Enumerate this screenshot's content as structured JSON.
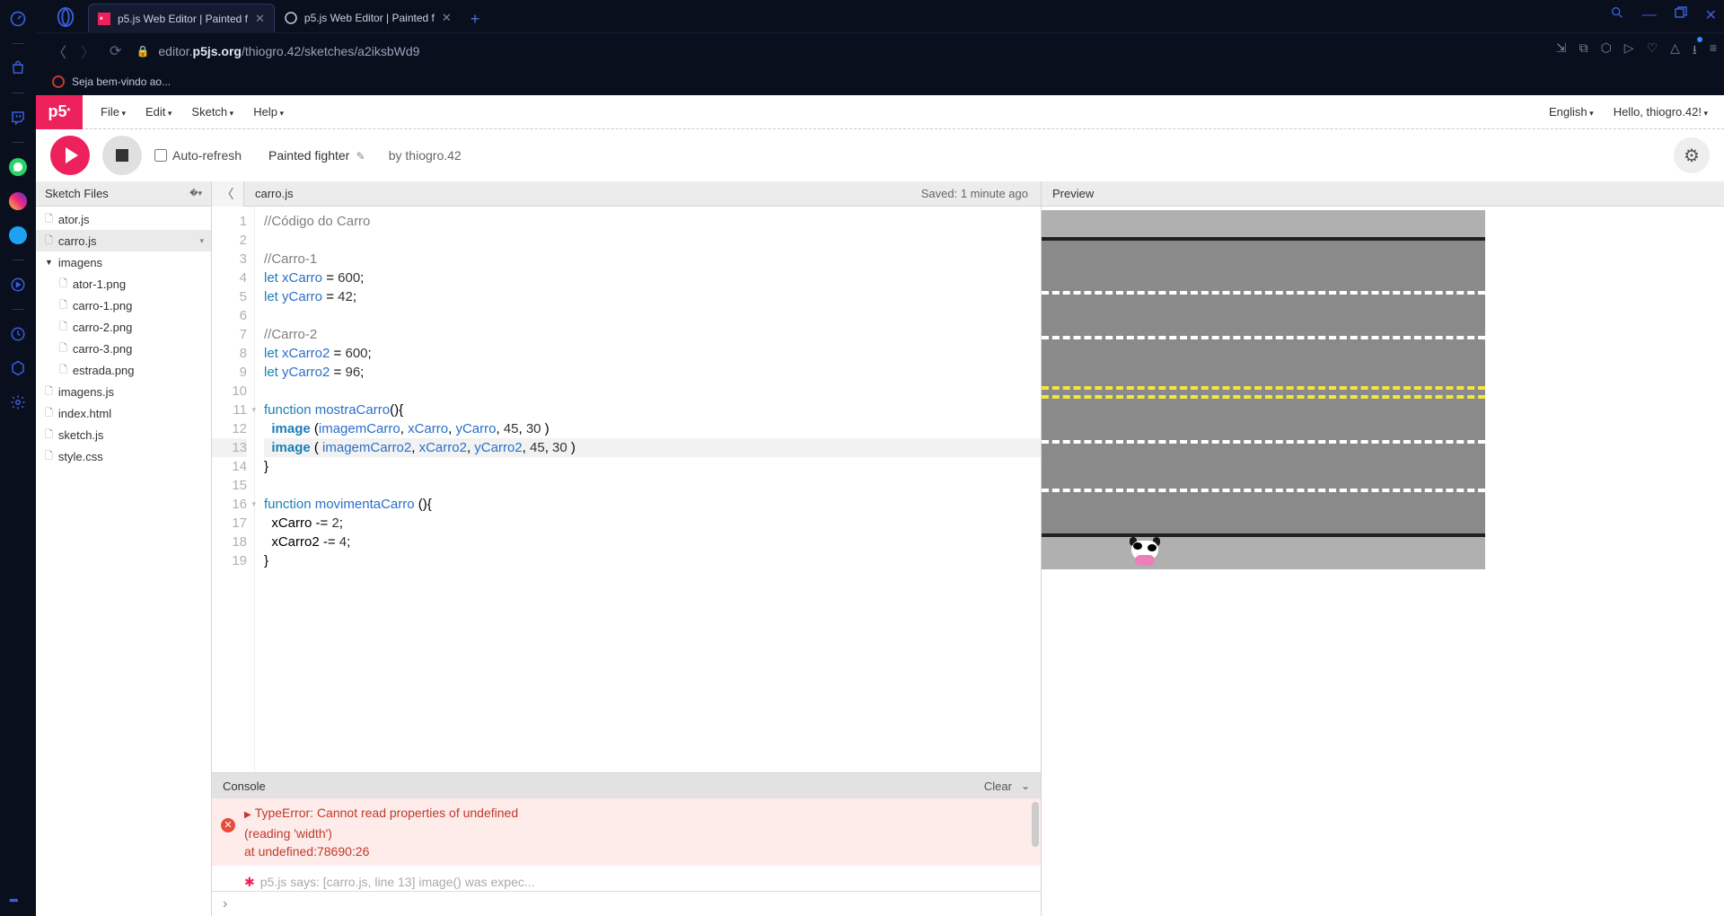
{
  "browser": {
    "tabs": [
      {
        "title": "p5.js Web Editor | Painted f",
        "active": true,
        "favicon": "p5-pink"
      },
      {
        "title": "p5.js Web Editor | Painted f",
        "active": false,
        "favicon": "p5-bw"
      }
    ],
    "url_domain": "editor.p5js.org",
    "url_path": "/thiogro.42/sketches/a2iksbWd9",
    "bookmark": "Seja bem-vindo ao..."
  },
  "p5": {
    "menus": [
      "File",
      "Edit",
      "Sketch",
      "Help"
    ],
    "language": "English",
    "greeting": "Hello, thiogro.42!",
    "auto_refresh": "Auto-refresh",
    "sketch_name": "Painted fighter",
    "author_prefix": "by ",
    "author": "thiogro.42",
    "files_header": "Sketch Files",
    "saved": "Saved: 1 minute ago",
    "preview": "Preview",
    "current_file": "carro.js",
    "files": [
      {
        "name": "ator.js",
        "type": "file",
        "depth": 0
      },
      {
        "name": "carro.js",
        "type": "file",
        "depth": 0,
        "selected": true
      },
      {
        "name": "imagens",
        "type": "folder",
        "depth": 0,
        "open": true
      },
      {
        "name": "ator-1.png",
        "type": "file",
        "depth": 1
      },
      {
        "name": "carro-1.png",
        "type": "file",
        "depth": 1
      },
      {
        "name": "carro-2.png",
        "type": "file",
        "depth": 1
      },
      {
        "name": "carro-3.png",
        "type": "file",
        "depth": 1
      },
      {
        "name": "estrada.png",
        "type": "file",
        "depth": 1
      },
      {
        "name": "imagens.js",
        "type": "file",
        "depth": 0
      },
      {
        "name": "index.html",
        "type": "file",
        "depth": 0
      },
      {
        "name": "sketch.js",
        "type": "file",
        "depth": 0
      },
      {
        "name": "style.css",
        "type": "file",
        "depth": 0
      }
    ],
    "code_lines": [
      {
        "n": 1,
        "html": "<span class='tok-comment'>//Código do Carro</span>"
      },
      {
        "n": 2,
        "html": ""
      },
      {
        "n": 3,
        "html": "<span class='tok-comment'>//Carro-1</span>"
      },
      {
        "n": 4,
        "html": "<span class='tok-keyword'>let</span> <span class='tok-var'>xCarro</span> = <span class='tok-num'>600</span>;"
      },
      {
        "n": 5,
        "html": "<span class='tok-keyword'>let</span> <span class='tok-var'>yCarro</span> = <span class='tok-num'>42</span>;"
      },
      {
        "n": 6,
        "html": ""
      },
      {
        "n": 7,
        "html": "<span class='tok-comment'>//Carro-2</span>"
      },
      {
        "n": 8,
        "html": "<span class='tok-keyword'>let</span> <span class='tok-var'>xCarro2</span> = <span class='tok-num'>600</span>;"
      },
      {
        "n": 9,
        "html": "<span class='tok-keyword'>let</span> <span class='tok-var'>yCarro2</span> = <span class='tok-num'>96</span>;"
      },
      {
        "n": 10,
        "html": ""
      },
      {
        "n": 11,
        "html": "<span class='tok-keyword'>function</span> <span class='tok-var'>mostraCarro</span>(){",
        "fold": true
      },
      {
        "n": 12,
        "html": "  <span class='tok-func tok-bold'>image</span> (<span class='tok-var'>imagemCarro</span>, <span class='tok-var'>xCarro</span>, <span class='tok-var'>yCarro</span>, <span class='tok-num'>45</span>, <span class='tok-num'>30</span> )"
      },
      {
        "n": 13,
        "html": "  <span class='tok-func tok-bold'>image</span> ( <span class='tok-var'>imagemCarro2</span>, <span class='tok-var'>xCarro2</span>, <span class='tok-var'>yCarro2</span>, <span class='tok-num'>45</span>, <span class='tok-num'>30</span> )",
        "hl": true
      },
      {
        "n": 14,
        "html": "}"
      },
      {
        "n": 15,
        "html": ""
      },
      {
        "n": 16,
        "html": "<span class='tok-keyword'>function</span> <span class='tok-var'>movimentaCarro</span> (){",
        "fold": true
      },
      {
        "n": 17,
        "html": "  xCarro -= <span class='tok-num'>2</span>;"
      },
      {
        "n": 18,
        "html": "  xCarro2 -= <span class='tok-num'>4</span>;"
      },
      {
        "n": 19,
        "html": "}"
      }
    ],
    "console": {
      "title": "Console",
      "clear": "Clear",
      "error_line1": "TypeError: Cannot read properties of undefined",
      "error_line2": "(reading 'width')",
      "error_line3": "    at undefined:78690:26",
      "truncated": "p5.js says: [carro.js, line 13] image() was expec..."
    }
  }
}
